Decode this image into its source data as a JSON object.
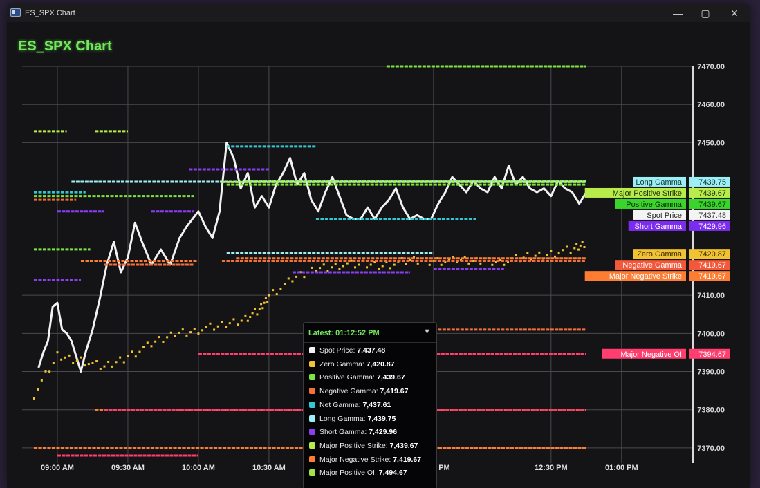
{
  "window": {
    "title": "ES_SPX Chart",
    "controls": {
      "minimize": "—",
      "maximize": "▢",
      "close": "✕"
    },
    "icon": "app-window-icon"
  },
  "chart_data": {
    "type": "line",
    "title": "ES_SPX Chart",
    "xlabel": "",
    "ylabel": "",
    "ylim": [
      7366,
      7470
    ],
    "y_ticks": [
      "7470.00",
      "7460.00",
      "7450.00",
      "7410.00",
      "7400.00",
      "7390.00",
      "7380.00",
      "7370.00"
    ],
    "x_ticks": [
      {
        "t": 540,
        "label": "09:00 AM"
      },
      {
        "t": 570,
        "label": "09:30 AM"
      },
      {
        "t": 600,
        "label": "10:00 AM"
      },
      {
        "t": 630,
        "label": "10:30 AM"
      },
      {
        "t": 700,
        "label": "12:00 PM"
      },
      {
        "t": 750,
        "label": "12:30 PM"
      },
      {
        "t": 780,
        "label": "01:00 PM"
      }
    ],
    "x_range": [
      "08:30 AM",
      "01:12 PM"
    ],
    "series": [
      {
        "name": "Spot Price",
        "color": "#f2f2f2",
        "kind": "line",
        "value": 7437.48,
        "points": [
          [
            532,
            7391
          ],
          [
            534,
            7395
          ],
          [
            536,
            7398
          ],
          [
            538,
            7407
          ],
          [
            540,
            7408
          ],
          [
            542,
            7401
          ],
          [
            544,
            7400
          ],
          [
            546,
            7398
          ],
          [
            548,
            7394
          ],
          [
            550,
            7390
          ],
          [
            552,
            7395
          ],
          [
            555,
            7401
          ],
          [
            558,
            7409
          ],
          [
            561,
            7418
          ],
          [
            564,
            7424
          ],
          [
            567,
            7416
          ],
          [
            570,
            7420
          ],
          [
            573,
            7429
          ],
          [
            576,
            7424
          ],
          [
            580,
            7418
          ],
          [
            584,
            7422
          ],
          [
            588,
            7418
          ],
          [
            592,
            7425
          ],
          [
            595,
            7428
          ],
          [
            600,
            7432
          ],
          [
            603,
            7428
          ],
          [
            606,
            7425
          ],
          [
            609,
            7432
          ],
          [
            612,
            7450
          ],
          [
            615,
            7446
          ],
          [
            618,
            7438
          ],
          [
            621,
            7442
          ],
          [
            624,
            7433
          ],
          [
            627,
            7436
          ],
          [
            630,
            7433
          ],
          [
            633,
            7439
          ],
          [
            636,
            7442
          ],
          [
            639,
            7446
          ],
          [
            642,
            7439
          ],
          [
            645,
            7442
          ],
          [
            648,
            7435
          ],
          [
            651,
            7432
          ],
          [
            654,
            7437
          ],
          [
            657,
            7441
          ],
          [
            660,
            7436
          ],
          [
            663,
            7431
          ],
          [
            666,
            7430
          ],
          [
            669,
            7430
          ],
          [
            672,
            7433
          ],
          [
            675,
            7430
          ],
          [
            678,
            7433
          ],
          [
            681,
            7435
          ],
          [
            684,
            7438
          ],
          [
            687,
            7433
          ],
          [
            690,
            7430
          ],
          [
            693,
            7431
          ],
          [
            696,
            7430
          ],
          [
            699,
            7430
          ],
          [
            702,
            7434
          ],
          [
            705,
            7437
          ],
          [
            708,
            7441
          ],
          [
            711,
            7439
          ],
          [
            714,
            7437
          ],
          [
            717,
            7440
          ],
          [
            720,
            7438
          ],
          [
            723,
            7437
          ],
          [
            726,
            7441
          ],
          [
            729,
            7438
          ],
          [
            732,
            7444
          ],
          [
            735,
            7439
          ],
          [
            738,
            7441
          ],
          [
            741,
            7438
          ],
          [
            744,
            7437
          ],
          [
            747,
            7438
          ],
          [
            750,
            7436
          ],
          [
            753,
            7440
          ],
          [
            756,
            7438
          ],
          [
            759,
            7437
          ],
          [
            762,
            7434
          ],
          [
            765,
            7437
          ]
        ]
      },
      {
        "name": "Zero Gamma",
        "color": "#f1c232",
        "kind": "scatter",
        "value": 7420.87,
        "points": [
          [
            530,
            7384
          ],
          [
            540,
            7394
          ],
          [
            550,
            7393
          ],
          [
            560,
            7391
          ],
          [
            570,
            7394
          ],
          [
            580,
            7397
          ],
          [
            590,
            7400
          ],
          [
            600,
            7401
          ],
          [
            610,
            7402
          ],
          [
            620,
            7404
          ],
          [
            626,
            7406
          ],
          [
            630,
            7410
          ],
          [
            640,
            7414
          ],
          [
            650,
            7417
          ],
          [
            660,
            7418
          ],
          [
            670,
            7418
          ],
          [
            680,
            7418
          ],
          [
            690,
            7419
          ],
          [
            700,
            7419
          ],
          [
            710,
            7419
          ],
          [
            720,
            7419
          ],
          [
            730,
            7419
          ],
          [
            740,
            7420
          ],
          [
            750,
            7421
          ],
          [
            760,
            7422
          ],
          [
            765,
            7424
          ]
        ]
      },
      {
        "name": "Positive Gamma",
        "color": "#7be33f",
        "kind": "segments",
        "value": 7439.67,
        "segments": [
          [
            530,
            554,
            7422
          ],
          [
            530,
            598,
            7436
          ],
          [
            612,
            765,
            7439
          ],
          [
            620,
            765,
            7440
          ],
          [
            680,
            765,
            7470
          ]
        ]
      },
      {
        "name": "Negative Gamma",
        "color": "#f4703a",
        "kind": "segments",
        "value": 7419.67,
        "segments": [
          [
            530,
            548,
            7435
          ],
          [
            560,
            598,
            7418
          ],
          [
            610,
            765,
            7419
          ],
          [
            700,
            765,
            7401
          ]
        ]
      },
      {
        "name": "Net Gamma",
        "color": "#33c7d4",
        "kind": "segments",
        "value": 7437.61,
        "segments": [
          [
            530,
            552,
            7437
          ],
          [
            612,
            650,
            7449
          ],
          [
            650,
            718,
            7430
          ]
        ]
      },
      {
        "name": "Long Gamma",
        "color": "#9ceff5",
        "kind": "segments",
        "value": 7439.75,
        "segments": [
          [
            546,
            765,
            7439.75
          ],
          [
            612,
            700,
            7421
          ]
        ]
      },
      {
        "name": "Short Gamma",
        "color": "#8a3df2",
        "kind": "segments",
        "value": 7429.96,
        "segments": [
          [
            540,
            560,
            7432
          ],
          [
            580,
            598,
            7432
          ],
          [
            596,
            630,
            7443
          ],
          [
            640,
            690,
            7416
          ],
          [
            530,
            550,
            7414
          ],
          [
            700,
            730,
            7417
          ]
        ]
      },
      {
        "name": "Major Positive Strike",
        "color": "#b7ec4a",
        "kind": "segments",
        "value": 7439.67,
        "segments": [
          [
            530,
            544,
            7453
          ],
          [
            556,
            570,
            7453
          ],
          [
            610,
            765,
            7439.67
          ]
        ]
      },
      {
        "name": "Major Negative Strike",
        "color": "#ff7d33",
        "kind": "segments",
        "value": 7419.67,
        "segments": [
          [
            550,
            600,
            7419
          ],
          [
            616,
            765,
            7419.67
          ],
          [
            556,
            765,
            7380
          ],
          [
            530,
            765,
            7370
          ]
        ]
      },
      {
        "name": "Major Negative OI",
        "color": "#ff3d6e",
        "kind": "segments",
        "value": 7394.67,
        "segments": [
          [
            600,
            765,
            7394.67
          ],
          [
            560,
            765,
            7380
          ],
          [
            540,
            600,
            7368
          ]
        ]
      },
      {
        "name": "Major Positive OI",
        "color": "#9fe24a",
        "kind": "segments",
        "value": 7494.67,
        "segments": []
      }
    ],
    "right_labels": [
      {
        "text": "Long Gamma",
        "value": "7439.75",
        "color": "#9ceff5",
        "y": 7439.75,
        "text_color": "#14383c"
      },
      {
        "text": "Major Positive Strike",
        "value": "7439.67",
        "color": "#b7ec4a",
        "y": 7439.67,
        "text_color": "#24330b"
      },
      {
        "text": "Positive Gamma",
        "value": "7439.67",
        "color": "#39d42c",
        "y": 7439.67,
        "text_color": "#0c2a08"
      },
      {
        "text": "Spot Price",
        "value": "7437.48",
        "color": "#f4f4f4",
        "y": 7437.48,
        "text_color": "#2c2c2c"
      },
      {
        "text": "Short Gamma",
        "value": "7429.96",
        "color": "#7b2cf0",
        "y": 7429.96,
        "text_color": "#ffffff"
      },
      {
        "text": "Zero Gamma",
        "value": "7420.87",
        "color": "#f1c232",
        "y": 7420.87,
        "text_color": "#3a2c00"
      },
      {
        "text": "Negative Gamma",
        "value": "7419.67",
        "color": "#f4583a",
        "y": 7419.67,
        "text_color": "#ffffff"
      },
      {
        "text": "Major Negative Strike",
        "value": "7419.67",
        "color": "#ff7d33",
        "y": 7419.67,
        "text_color": "#ffffff"
      },
      {
        "text": "Major Negative OI",
        "value": "7394.67",
        "color": "#ff3d6e",
        "y": 7394.67,
        "text_color": "#ffffff"
      }
    ],
    "grid": true,
    "legend": "floating tooltip bottom-center"
  },
  "tooltip": {
    "title": "Latest: 01:12:52 PM",
    "chevron_icon": "chevron-down-icon",
    "rows": [
      {
        "label": "Spot Price:",
        "value": "7,437.48",
        "color": "#f2f2f2"
      },
      {
        "label": "Zero Gamma:",
        "value": "7,420.87",
        "color": "#f1c232"
      },
      {
        "label": "Positive Gamma:",
        "value": "7,439.67",
        "color": "#7be33f"
      },
      {
        "label": "Negative Gamma:",
        "value": "7,419.67",
        "color": "#f4703a"
      },
      {
        "label": "Net Gamma:",
        "value": "7,437.61",
        "color": "#33c7d4"
      },
      {
        "label": "Long Gamma:",
        "value": "7,439.75",
        "color": "#9ceff5"
      },
      {
        "label": "Short Gamma:",
        "value": "7,429.96",
        "color": "#8a3df2"
      },
      {
        "label": "Major Positive Strike:",
        "value": "7,439.67",
        "color": "#b7ec4a"
      },
      {
        "label": "Major Negative Strike:",
        "value": "7,419.67",
        "color": "#ff7d33"
      },
      {
        "label": "Major Positive OI:",
        "value": "7,494.67",
        "color": "#9fe24a"
      }
    ]
  }
}
